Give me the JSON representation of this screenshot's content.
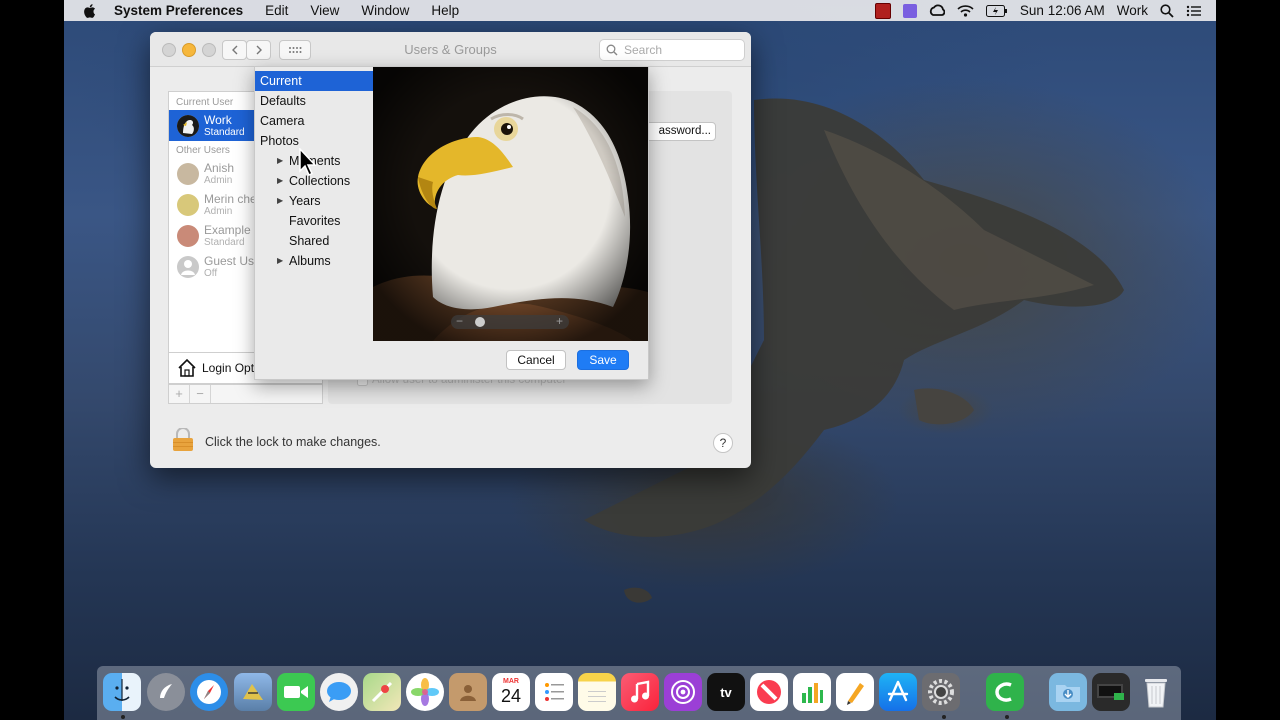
{
  "menubar": {
    "app_name": "System Preferences",
    "menus": [
      "Edit",
      "View",
      "Window",
      "Help"
    ],
    "clock": "Sun 12:06 AM",
    "user": "Work"
  },
  "window": {
    "title": "Users & Groups",
    "search_placeholder": "Search"
  },
  "user_list": {
    "current_header": "Current User",
    "other_header": "Other Users",
    "current": {
      "name": "Work",
      "role": "Standard"
    },
    "others": [
      {
        "name": "Anish",
        "role": "Admin"
      },
      {
        "name": "Merin che",
        "role": "Admin"
      },
      {
        "name": "Example",
        "role": "Standard"
      },
      {
        "name": "Guest Us",
        "role": "Off"
      }
    ],
    "login_options": "Login Opt",
    "add": "+",
    "remove": "−"
  },
  "right_pane": {
    "change_password_button": "assword...",
    "allow_admin_label": "Allow user to administer this computer"
  },
  "footer": {
    "lock_text": "Click the lock to make changes.",
    "help": "?"
  },
  "picker": {
    "sources": [
      "Current",
      "Defaults",
      "Camera",
      "Photos"
    ],
    "selected_source": "Current",
    "photo_items": [
      {
        "label": "Moments",
        "expandable": true
      },
      {
        "label": "Collections",
        "expandable": true
      },
      {
        "label": "Years",
        "expandable": true
      },
      {
        "label": "Favorites",
        "expandable": false
      },
      {
        "label": "Shared",
        "expandable": false
      },
      {
        "label": "Albums",
        "expandable": true
      }
    ],
    "cancel": "Cancel",
    "save": "Save",
    "zoom_level": 0.12
  },
  "dock": {
    "icons": [
      "finder-icon",
      "launchpad-icon",
      "safari-icon",
      "mail-icon",
      "facetime-icon",
      "messages-icon",
      "maps-icon",
      "photos-icon",
      "contacts-icon",
      "calendar-icon",
      "reminders-icon",
      "notes-icon",
      "music-icon",
      "podcasts-icon",
      "tv-icon",
      "news-icon",
      "numbers-icon",
      "pages-icon",
      "app-store-icon",
      "system-preferences-icon",
      "camtasia-icon",
      "downloads-folder-icon",
      "screen-recording-icon",
      "trash-icon"
    ],
    "calendar_month": "MAR",
    "calendar_day": "24",
    "tv_label": "tv"
  }
}
